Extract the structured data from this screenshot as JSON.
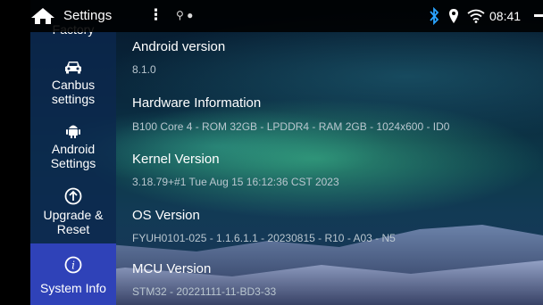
{
  "status_bar": {
    "title": "Settings",
    "menu_dots": "⋮",
    "usb_status": "⚲ ●",
    "time": "08:41",
    "icons": [
      "home-icon",
      "more-icon",
      "usb-icon",
      "bluetooth-icon",
      "location-icon",
      "wifi-icon"
    ],
    "accent_bluetooth": "#2aa3ff"
  },
  "sidebar": {
    "items": [
      {
        "label": "Factory",
        "icon": "factory-icon",
        "active": false
      },
      {
        "label": "Canbus settings",
        "line1": "Canbus",
        "line2": "settings",
        "icon": "car-icon",
        "active": false
      },
      {
        "label": "Android Settings",
        "line1": "Android",
        "line2": "Settings",
        "icon": "android-icon",
        "active": false
      },
      {
        "label": "Upgrade & Reset",
        "line1": "Upgrade &",
        "line2": "Reset",
        "icon": "upgrade-icon",
        "active": false
      },
      {
        "label": "System Info",
        "icon": "info-icon",
        "active": true
      }
    ],
    "active_color": "#2f42b8"
  },
  "system_info": {
    "android_version": {
      "title": "Android version",
      "value": "8.1.0"
    },
    "hardware_information": {
      "title": "Hardware Information",
      "value": "B100 Core 4 - ROM 32GB - LPDDR4 - RAM 2GB - 1024x600 - ID0"
    },
    "kernel_version": {
      "title": "Kernel Version",
      "value": "3.18.79+#1 Tue Aug 15 16:12:36 CST 2023"
    },
    "os_version": {
      "title": "OS Version",
      "value": "FYUH0101-025 - 1.1.6.1.1 - 20230815 - R10 - A03 - N5"
    },
    "mcu_version": {
      "title": "MCU Version",
      "value": "STM32 - 20221111-11-BD3-33"
    }
  }
}
